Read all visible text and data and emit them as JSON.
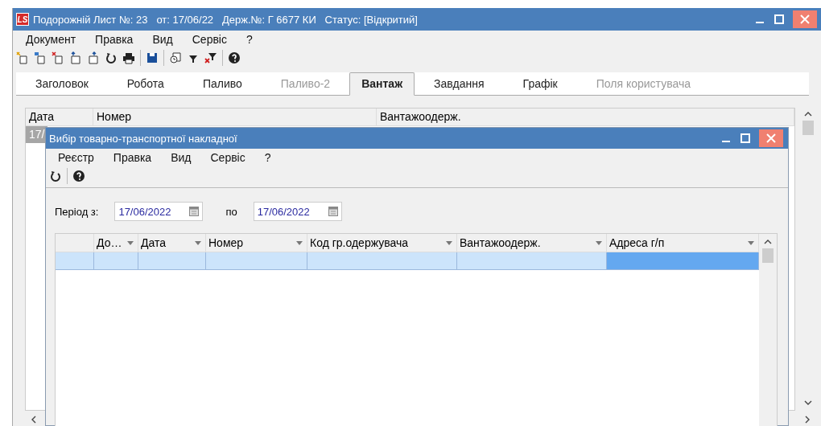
{
  "window": {
    "logo": "LS",
    "title": "Подорожній Лист №: 23   от: 17/06/22   Держ.№: Г 6677 КИ   Статус: [Відкритий]"
  },
  "menu": [
    "Документ",
    "Правка",
    "Вид",
    "Сервіс",
    "?"
  ],
  "tabs": [
    {
      "label": "Заголовок",
      "selected": false,
      "disabled": false
    },
    {
      "label": "Робота",
      "selected": false,
      "disabled": false
    },
    {
      "label": "Паливо",
      "selected": false,
      "disabled": false
    },
    {
      "label": "Паливо-2",
      "selected": false,
      "disabled": true
    },
    {
      "label": "Вантаж",
      "selected": true,
      "disabled": false
    },
    {
      "label": "Завдання",
      "selected": false,
      "disabled": false
    },
    {
      "label": "Графік",
      "selected": false,
      "disabled": false
    },
    {
      "label": "Поля користувача",
      "selected": false,
      "disabled": true
    }
  ],
  "table": {
    "columns": [
      "Дата",
      "Номер",
      "Вантажоодерж."
    ],
    "rows": [
      {
        "cells": [
          "17/"
        ],
        "selected": true
      }
    ]
  },
  "dialog": {
    "title": "Вибір товарно-транспортної накладної",
    "menu": [
      "Реєстр",
      "Правка",
      "Вид",
      "Сервіс",
      "?"
    ],
    "period": {
      "label": "Період з:",
      "from": "17/06/2022",
      "to_label": "по",
      "to": "17/06/2022"
    },
    "table": {
      "columns": [
        "До…",
        "Дата",
        "Номер",
        "Код гр.одержувача",
        "Вантажоодерж.",
        "Адреса г/п"
      ],
      "rows": [
        {
          "selected": true,
          "cells": [
            {
              "focused": false
            },
            {
              "focused": false
            },
            {
              "focused": false
            },
            {
              "focused": false
            },
            {
              "focused": false
            },
            {
              "focused": false
            },
            {
              "focused": true
            }
          ]
        }
      ]
    }
  }
}
